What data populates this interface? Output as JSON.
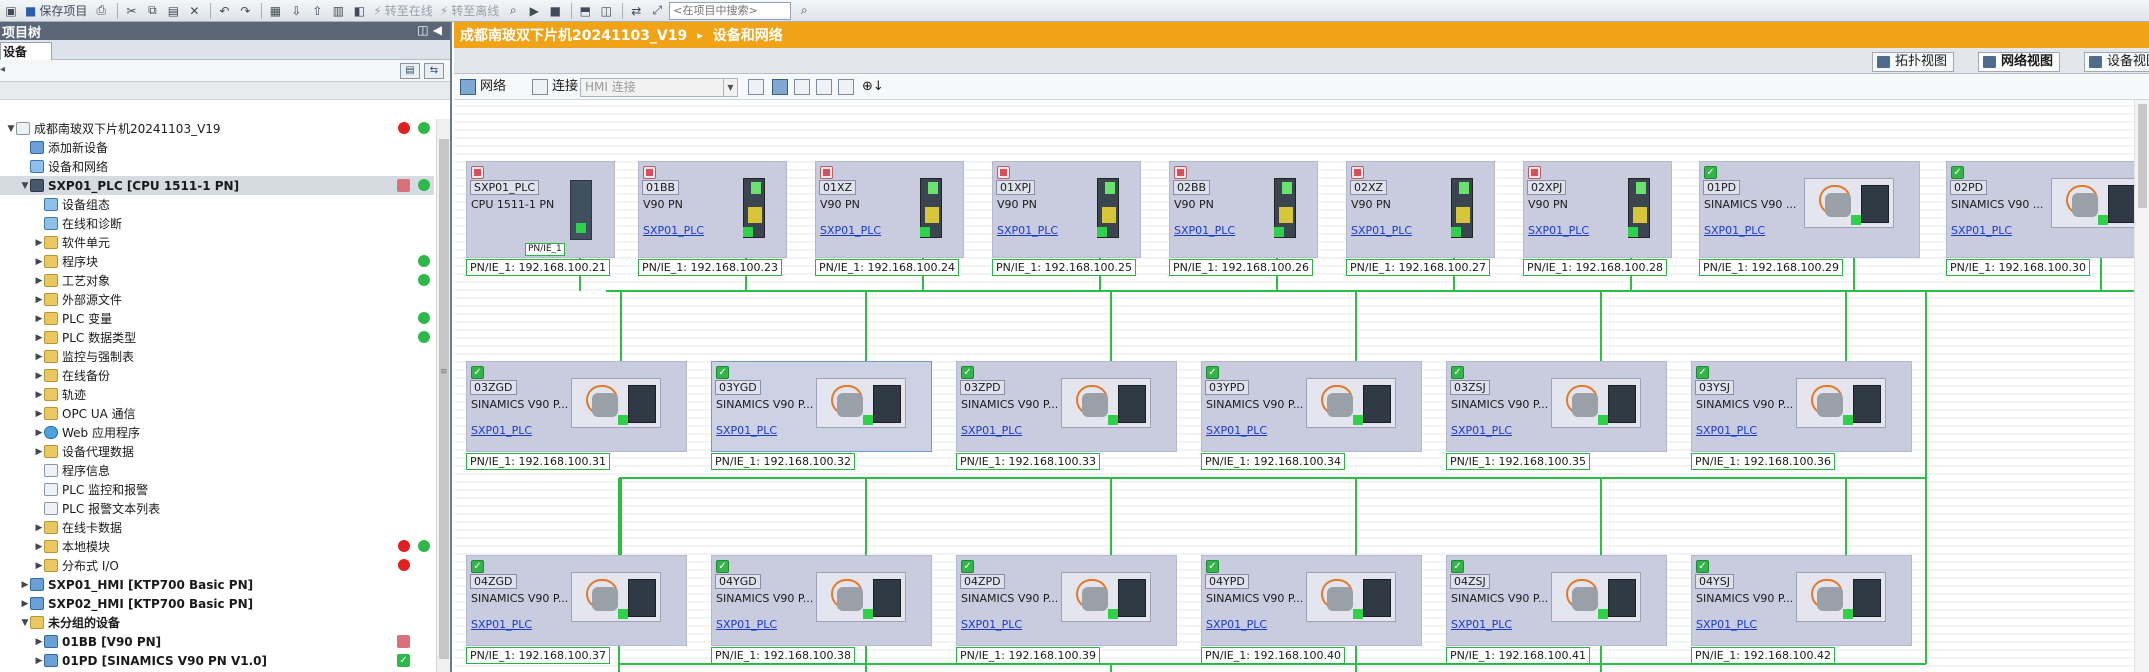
{
  "toolbar": {
    "save_label": "保存项目",
    "go_online_label": "转至在线",
    "go_offline_label": "转至离线",
    "search_placeholder": "<在项目中搜索>"
  },
  "project_tree": {
    "header_title": "项目树",
    "tab_label": "设备",
    "items": [
      {
        "label": "成都南玻双下片机20241103_V19",
        "level": 0,
        "arrow": "▼",
        "icon": "project-icon",
        "status": "red-green"
      },
      {
        "label": "添加新设备",
        "level": 1,
        "arrow": "",
        "icon": "add-device-icon",
        "status": ""
      },
      {
        "label": "设备和网络",
        "level": 1,
        "arrow": "",
        "icon": "network-icon",
        "status": ""
      },
      {
        "label": "SXP01_PLC [CPU 1511-1 PN]",
        "level": 1,
        "arrow": "▼",
        "icon": "plc-icon",
        "status": "redbox-green",
        "selected": true
      },
      {
        "label": "设备组态",
        "level": 2,
        "arrow": "",
        "icon": "device-config-icon",
        "status": ""
      },
      {
        "label": "在线和诊断",
        "level": 2,
        "arrow": "",
        "icon": "online-diagnostics-icon",
        "status": ""
      },
      {
        "label": "软件单元",
        "level": 2,
        "arrow": "▶",
        "icon": "folder-icon",
        "status": ""
      },
      {
        "label": "程序块",
        "level": 2,
        "arrow": "▶",
        "icon": "folder-icon",
        "status": "green"
      },
      {
        "label": "工艺对象",
        "level": 2,
        "arrow": "▶",
        "icon": "folder-icon",
        "status": "green"
      },
      {
        "label": "外部源文件",
        "level": 2,
        "arrow": "▶",
        "icon": "folder-icon",
        "status": ""
      },
      {
        "label": "PLC 变量",
        "level": 2,
        "arrow": "▶",
        "icon": "folder-icon",
        "status": "green"
      },
      {
        "label": "PLC 数据类型",
        "level": 2,
        "arrow": "▶",
        "icon": "folder-icon",
        "status": "green"
      },
      {
        "label": "监控与强制表",
        "level": 2,
        "arrow": "▶",
        "icon": "folder-icon",
        "status": ""
      },
      {
        "label": "在线备份",
        "level": 2,
        "arrow": "▶",
        "icon": "folder-icon",
        "status": ""
      },
      {
        "label": "轨迹",
        "level": 2,
        "arrow": "▶",
        "icon": "folder-icon",
        "status": ""
      },
      {
        "label": "OPC UA 通信",
        "level": 2,
        "arrow": "▶",
        "icon": "folder-icon",
        "status": ""
      },
      {
        "label": "Web 应用程序",
        "level": 2,
        "arrow": "▶",
        "icon": "web-icon",
        "status": ""
      },
      {
        "label": "设备代理数据",
        "level": 2,
        "arrow": "▶",
        "icon": "folder-icon",
        "status": ""
      },
      {
        "label": "程序信息",
        "level": 2,
        "arrow": "",
        "icon": "doc-icon",
        "status": ""
      },
      {
        "label": "PLC 监控和报警",
        "level": 2,
        "arrow": "",
        "icon": "doc-icon",
        "status": ""
      },
      {
        "label": "PLC 报警文本列表",
        "level": 2,
        "arrow": "",
        "icon": "doc-icon",
        "status": ""
      },
      {
        "label": "在线卡数据",
        "level": 2,
        "arrow": "▶",
        "icon": "folder-icon",
        "status": ""
      },
      {
        "label": "本地模块",
        "level": 2,
        "arrow": "▶",
        "icon": "folder-icon",
        "status": "red-green"
      },
      {
        "label": "分布式 I/O",
        "level": 2,
        "arrow": "▶",
        "icon": "folder-icon",
        "status": "red"
      },
      {
        "label": "SXP01_HMI [KTP700 Basic PN]",
        "level": 1,
        "arrow": "▶",
        "icon": "hmi-icon",
        "status": "",
        "bold": true
      },
      {
        "label": "SXP02_HMI [KTP700 Basic PN]",
        "level": 1,
        "arrow": "▶",
        "icon": "hmi-icon",
        "status": "",
        "bold": true
      },
      {
        "label": "未分组的设备",
        "level": 1,
        "arrow": "▼",
        "icon": "folder-icon",
        "status": "",
        "bold": true
      },
      {
        "label": "01BB [V90 PN]",
        "level": 2,
        "arrow": "▶",
        "icon": "drive-icon",
        "status": "redbox",
        "bold": true
      },
      {
        "label": "01PD [SINAMICS V90 PN V1.0]",
        "level": 2,
        "arrow": "▶",
        "icon": "drive-icon",
        "status": "greenbox",
        "bold": true
      }
    ]
  },
  "editor": {
    "breadcrumb_project": "成都南玻双下片机20241103_V19",
    "breadcrumb_sep": "▸",
    "breadcrumb_page": "设备和网络",
    "view_tabs": [
      "拓扑视图",
      "网络视图",
      "设备视图"
    ],
    "network_button": "网络",
    "connect_button": "连接",
    "connection_select": "HMI 连接"
  },
  "devices": [
    {
      "name": "SXP01_PLC",
      "type": "CPU 1511-1 PN",
      "link": "",
      "iface": "PN/IE_1: 192.168.100.21",
      "kind": "plc",
      "status": "red"
    },
    {
      "name": "01BB",
      "type": "V90 PN",
      "link": "SXP01_PLC",
      "iface": "PN/IE_1: 192.168.100.23",
      "kind": "v90",
      "status": "red"
    },
    {
      "name": "01XZ",
      "type": "V90 PN",
      "link": "SXP01_PLC",
      "iface": "PN/IE_1: 192.168.100.24",
      "kind": "v90",
      "status": "red"
    },
    {
      "name": "01XPJ",
      "type": "V90 PN",
      "link": "SXP01_PLC",
      "iface": "PN/IE_1: 192.168.100.25",
      "kind": "v90",
      "status": "red"
    },
    {
      "name": "02BB",
      "type": "V90 PN",
      "link": "SXP01_PLC",
      "iface": "PN/IE_1: 192.168.100.26",
      "kind": "v90",
      "status": "red"
    },
    {
      "name": "02XZ",
      "type": "V90 PN",
      "link": "SXP01_PLC",
      "iface": "PN/IE_1: 192.168.100.27",
      "kind": "v90",
      "status": "red"
    },
    {
      "name": "02XPJ",
      "type": "V90 PN",
      "link": "SXP01_PLC",
      "iface": "PN/IE_1: 192.168.100.28",
      "kind": "v90",
      "status": "red"
    },
    {
      "name": "01PD",
      "type": "SINAMICS V90 ...",
      "link": "SXP01_PLC",
      "iface": "PN/IE_1: 192.168.100.29",
      "kind": "motor",
      "status": "green"
    },
    {
      "name": "02PD",
      "type": "SINAMICS V90 ...",
      "link": "SXP01_PLC",
      "iface": "PN/IE_1: 192.168.100.30",
      "kind": "motor",
      "status": "green"
    },
    {
      "name": "03ZGD",
      "type": "SINAMICS V90 P...",
      "link": "SXP01_PLC",
      "iface": "PN/IE_1: 192.168.100.31",
      "kind": "motor",
      "status": "green"
    },
    {
      "name": "03YGD",
      "type": "SINAMICS V90 P...",
      "link": "SXP01_PLC",
      "iface": "PN/IE_1: 192.168.100.32",
      "kind": "motor",
      "status": "green"
    },
    {
      "name": "03ZPD",
      "type": "SINAMICS V90 P...",
      "link": "SXP01_PLC",
      "iface": "PN/IE_1: 192.168.100.33",
      "kind": "motor",
      "status": "green"
    },
    {
      "name": "03YPD",
      "type": "SINAMICS V90 P...",
      "link": "SXP01_PLC",
      "iface": "PN/IE_1: 192.168.100.34",
      "kind": "motor",
      "status": "green"
    },
    {
      "name": "03ZSJ",
      "type": "SINAMICS V90 P...",
      "link": "SXP01_PLC",
      "iface": "PN/IE_1: 192.168.100.35",
      "kind": "motor",
      "status": "green"
    },
    {
      "name": "03YSJ",
      "type": "SINAMICS V90 P...",
      "link": "SXP01_PLC",
      "iface": "PN/IE_1: 192.168.100.36",
      "kind": "motor",
      "status": "green"
    },
    {
      "name": "04ZGD",
      "type": "SINAMICS V90 P...",
      "link": "SXP01_PLC",
      "iface": "PN/IE_1: 192.168.100.37",
      "kind": "motor",
      "status": "green"
    },
    {
      "name": "04YGD",
      "type": "SINAMICS V90 P...",
      "link": "SXP01_PLC",
      "iface": "PN/IE_1: 192.168.100.38",
      "kind": "motor",
      "status": "green"
    },
    {
      "name": "04ZPD",
      "type": "SINAMICS V90 P...",
      "link": "SXP01_PLC",
      "iface": "PN/IE_1: 192.168.100.39",
      "kind": "motor",
      "status": "green"
    },
    {
      "name": "04YPD",
      "type": "SINAMICS V90 P...",
      "link": "SXP01_PLC",
      "iface": "PN/IE_1: 192.168.100.40",
      "kind": "motor",
      "status": "green"
    },
    {
      "name": "04ZSJ",
      "type": "SINAMICS V90 P...",
      "link": "SXP01_PLC",
      "iface": "PN/IE_1: 192.168.100.41",
      "kind": "motor",
      "status": "green"
    },
    {
      "name": "04YSJ",
      "type": "SINAMICS V90 P...",
      "link": "SXP01_PLC",
      "iface": "PN/IE_1: 192.168.100.42",
      "kind": "motor",
      "status": "green"
    }
  ],
  "plc_small_label": "PN/IE_1",
  "colors": {
    "breadcrumb": "#f0a316",
    "network_wire": "#2dbf45",
    "device_bg": "#c9ccdf",
    "link": "#1a3ad0"
  }
}
